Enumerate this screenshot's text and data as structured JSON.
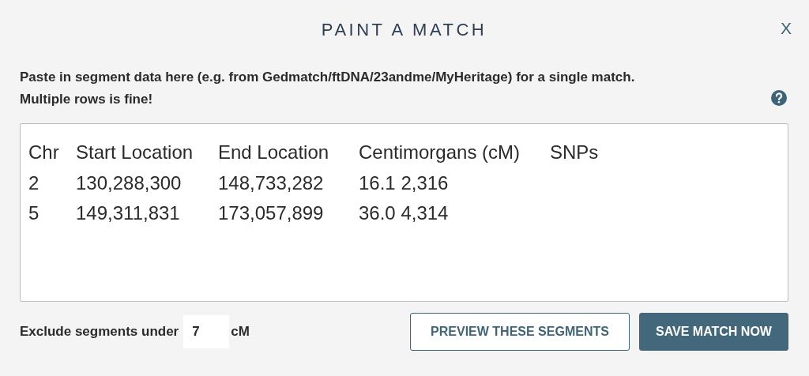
{
  "dialog": {
    "title": "PAINT A MATCH",
    "close": "X"
  },
  "instructions": [
    "Paste in segment data here (e.g. from Gedmatch/ftDNA/23andme/MyHeritage) for a single match.",
    "Multiple rows is fine!"
  ],
  "segment_data": {
    "lines": [
      [
        "Chr",
        "Start Location",
        "End Location",
        "Centimorgans (cM)",
        "SNPs"
      ],
      [
        "2",
        "130,288,300",
        "148,733,282",
        "16.1 2,316"
      ],
      [
        "5",
        "149,311,831",
        "173,057,899",
        "36.0 4,314"
      ]
    ]
  },
  "threshold": {
    "label": "Exclude segments under",
    "value": "7",
    "unit": "cM"
  },
  "buttons": [
    {
      "label": "PREVIEW THESE SEGMENTS",
      "kind": "outline"
    },
    {
      "label": "SAVE MATCH NOW",
      "kind": "primary"
    }
  ]
}
